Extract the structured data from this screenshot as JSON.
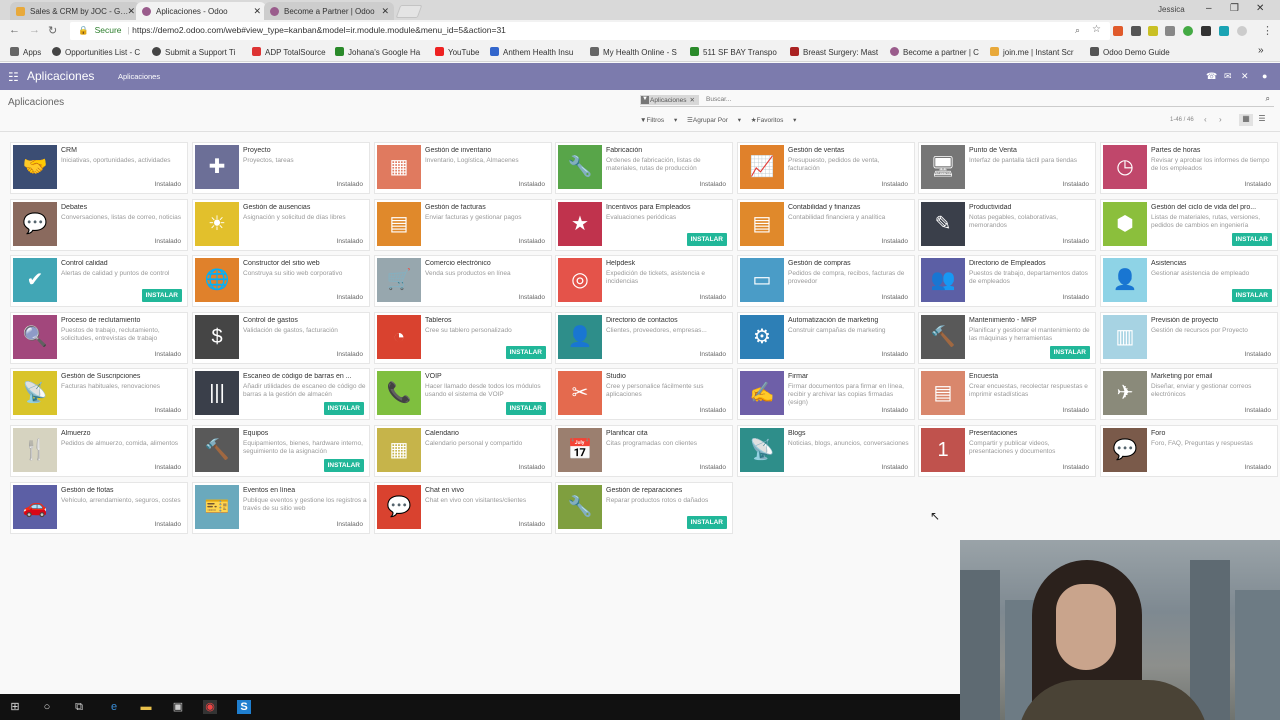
{
  "browser": {
    "tabs": [
      {
        "title": "Sales & CRM by JOC - G…",
        "fav": "#e8a93b",
        "icon": "drive-icon"
      },
      {
        "title": "Aplicaciones - Odoo",
        "fav": "#9a5c8c",
        "icon": "odoo-icon"
      },
      {
        "title": "Become a Partner | Odoo",
        "fav": "#9a5c8c",
        "icon": "odoo-icon"
      }
    ],
    "user": "Jessica",
    "secure_label": "Secure",
    "url": "https://demo2.odoo.com/web#view_type=kanban&model=ir.module.module&menu_id=5&action=31",
    "apps_label": "Apps",
    "bookmarks": [
      {
        "label": "Opportunities List - C",
        "color": "#444"
      },
      {
        "label": "Submit a Support Ti",
        "color": "#444"
      },
      {
        "label": "ADP TotalSource",
        "color": "#d33"
      },
      {
        "label": "Johana's Google Ha",
        "color": "#2a8a2a"
      },
      {
        "label": "YouTube",
        "color": "#e22"
      },
      {
        "label": "Anthem Health Insu",
        "color": "#36c"
      },
      {
        "label": "My Health Online - S",
        "color": "#666"
      },
      {
        "label": "511 SF BAY Transpo",
        "color": "#2a8a2a"
      },
      {
        "label": "Breast Surgery: Mast",
        "color": "#a22"
      },
      {
        "label": "Become a partner | C",
        "color": "#9a5c8c"
      },
      {
        "label": "join.me | Instant Scr",
        "color": "#e8a93b"
      },
      {
        "label": "Odoo Demo Guide",
        "color": "#555"
      }
    ]
  },
  "header": {
    "title": "Aplicaciones",
    "menu": "Aplicaciones"
  },
  "control": {
    "breadcrumb": "Aplicaciones",
    "facet": "Aplicaciones",
    "search_placeholder": "Buscar...",
    "filters": "Filtros",
    "group_by": "Agrupar Por",
    "favorites": "Favoritos",
    "pager": "1-46 / 46"
  },
  "labels": {
    "installed": "Instalado",
    "install": "INSTALAR"
  },
  "apps": [
    {
      "name": "CRM",
      "desc": "Iniciativas, oportunidades, actividades",
      "status": "installed",
      "color": "#3b4d73",
      "glyph": "🤝"
    },
    {
      "name": "Proyecto",
      "desc": "Proyectos, tareas",
      "status": "installed",
      "color": "#6c6f97",
      "glyph": "✚"
    },
    {
      "name": "Gestión de inventario",
      "desc": "Inventario, Logística, Almacenes",
      "status": "installed",
      "color": "#e07a5f",
      "glyph": "▦"
    },
    {
      "name": "Fabricación",
      "desc": "Órdenes de fabricación, listas de materiales, rutas de producción",
      "status": "installed",
      "color": "#58a549",
      "glyph": "🔧"
    },
    {
      "name": "Gestión de ventas",
      "desc": "Presupuesto, pedidos de venta, facturación",
      "status": "installed",
      "color": "#e0812b",
      "glyph": "📈"
    },
    {
      "name": "Punto de Venta",
      "desc": "Interfaz de pantalla táctil para tiendas",
      "status": "installed",
      "color": "#767676",
      "glyph": "🖥"
    },
    {
      "name": "Partes de horas",
      "desc": "Revisar y aprobar los informes de tiempo de los empleados",
      "status": "installed",
      "color": "#c0476b",
      "glyph": "◷"
    },
    {
      "name": "Debates",
      "desc": "Conversaciones, listas de correo, noticias",
      "status": "installed",
      "color": "#8a6a5e",
      "glyph": "💬"
    },
    {
      "name": "Gestión de ausencias",
      "desc": "Asignación y solicitud de días libres",
      "status": "installed",
      "color": "#e2c02c",
      "glyph": "☀"
    },
    {
      "name": "Gestión de facturas",
      "desc": "Enviar facturas y gestionar pagos",
      "status": "installed",
      "color": "#e0892b",
      "glyph": "▤"
    },
    {
      "name": "Incentivos para Empleados",
      "desc": "Evaluaciones periódicas",
      "status": "install",
      "color": "#c0334d",
      "glyph": "★"
    },
    {
      "name": "Contabilidad y finanzas",
      "desc": "Contabilidad financiera y analítica",
      "status": "installed",
      "color": "#e0892b",
      "glyph": "▤"
    },
    {
      "name": "Productividad",
      "desc": "Notas pegables, colaborativas, memorandos",
      "status": "installed",
      "color": "#3a3f4a",
      "glyph": "✎"
    },
    {
      "name": "Gestión del ciclo de vida del pro...",
      "desc": "Listas de materiales, rutas, versiones, pedidos de cambios en ingeniería",
      "status": "install",
      "color": "#8bbf3c",
      "glyph": "⬢"
    },
    {
      "name": "Control calidad",
      "desc": "Alertas de calidad y puntos de control",
      "status": "install",
      "color": "#41a6b5",
      "glyph": "✔"
    },
    {
      "name": "Constructor del sitio web",
      "desc": "Construya su sitio web corporativo",
      "status": "installed",
      "color": "#e0812b",
      "glyph": "🌐"
    },
    {
      "name": "Comercio electrónico",
      "desc": "Venda sus productos en línea",
      "status": "installed",
      "color": "#97a7ae",
      "glyph": "🛒"
    },
    {
      "name": "Helpdesk",
      "desc": "Expedición de tickets, asistencia e incidencias",
      "status": "installed",
      "color": "#e4534a",
      "glyph": "◎"
    },
    {
      "name": "Gestión de compras",
      "desc": "Pedidos de compra, recibos, facturas de proveedor",
      "status": "installed",
      "color": "#4a9cc7",
      "glyph": "▭"
    },
    {
      "name": "Directorio de Empleados",
      "desc": "Puestos de trabajo, departamentos datos de empleados",
      "status": "installed",
      "color": "#5c5fa5",
      "glyph": "👥"
    },
    {
      "name": "Asistencias",
      "desc": "Gestionar asistencia de empleado",
      "status": "install",
      "color": "#8ed3e6",
      "glyph": "👤"
    },
    {
      "name": "Proceso de reclutamiento",
      "desc": "Puestos de trabajo, reclutamiento, solicitudes, entrevistas de trabajo",
      "status": "installed",
      "color": "#a2477c",
      "glyph": "🔍"
    },
    {
      "name": "Control de gastos",
      "desc": "Validación de gastos, facturación",
      "status": "installed",
      "color": "#454545",
      "glyph": "$"
    },
    {
      "name": "Tableros",
      "desc": "Cree su tablero personalizado",
      "status": "install",
      "color": "#d9422f",
      "glyph": "◔"
    },
    {
      "name": "Directorio de contactos",
      "desc": "Clientes, proveedores, empresas...",
      "status": "installed",
      "color": "#2e8e8a",
      "glyph": "👤"
    },
    {
      "name": "Automatización de marketing",
      "desc": "Construir campañas de marketing",
      "status": "installed",
      "color": "#2d7fb6",
      "glyph": "⚙"
    },
    {
      "name": "Mantenimiento - MRP",
      "desc": "Planificar y gestionar el mantenimiento de las máquinas y herramientas",
      "status": "install",
      "color": "#595959",
      "glyph": "🔨"
    },
    {
      "name": "Previsión de proyecto",
      "desc": "Gestión de recursos por Proyecto",
      "status": "installed",
      "color": "#a7d3e3",
      "glyph": "▥"
    },
    {
      "name": "Gestión de Suscripciones",
      "desc": "Facturas habituales, renovaciones",
      "status": "installed",
      "color": "#d9c42a",
      "glyph": "📡"
    },
    {
      "name": "Escaneo de código de barras en ...",
      "desc": "Añadir utilidades de escaneo de código de barras a la gestión de almacén",
      "status": "install",
      "color": "#3a3f4a",
      "glyph": "|||"
    },
    {
      "name": "VOIP",
      "desc": "Hacer llamado desde todos los módulos usando el sistema de VOIP",
      "status": "install",
      "color": "#7fbf3f",
      "glyph": "📞"
    },
    {
      "name": "Studio",
      "desc": "Cree y personalice fácilmente sus aplicaciones",
      "status": "installed",
      "color": "#e46a4e",
      "glyph": "✂"
    },
    {
      "name": "Firmar",
      "desc": "Firmar documentos para firmar en línea, recibir y archivar las copias firmadas (esign)",
      "status": "installed",
      "color": "#6e5fa8",
      "glyph": "✍"
    },
    {
      "name": "Encuesta",
      "desc": "Crear encuestas, recolectar respuestas e imprimir estadísticas",
      "status": "installed",
      "color": "#d9876c",
      "glyph": "▤"
    },
    {
      "name": "Marketing por email",
      "desc": "Diseñar, enviar y gestionar correos electrónicos",
      "status": "installed",
      "color": "#8a8a7a",
      "glyph": "✈"
    },
    {
      "name": "Almuerzo",
      "desc": "Pedidos de almuerzo, comida, alimentos",
      "status": "installed",
      "color": "#d6d3c0",
      "glyph": "🍴"
    },
    {
      "name": "Equipos",
      "desc": "Equipamientos, bienes, hardware interno, seguimiento de la asignación",
      "status": "install",
      "color": "#595959",
      "glyph": "🔨"
    },
    {
      "name": "Calendario",
      "desc": "Calendario personal y compartido",
      "status": "installed",
      "color": "#c6b44a",
      "glyph": "▦"
    },
    {
      "name": "Planificar cita",
      "desc": "Citas programadas con clientes",
      "status": "installed",
      "color": "#9b7f6f",
      "glyph": "📅"
    },
    {
      "name": "Blogs",
      "desc": "Noticias, blogs, anuncios, conversaciones",
      "status": "installed",
      "color": "#2e8e8a",
      "glyph": "📡"
    },
    {
      "name": "Presentaciones",
      "desc": "Compartir y publicar videos, presentaciones y documentos",
      "status": "installed",
      "color": "#c0524d",
      "glyph": "1"
    },
    {
      "name": "Foro",
      "desc": "Foro, FAQ, Preguntas y respuestas",
      "status": "installed",
      "color": "#7a5a4a",
      "glyph": "💬"
    },
    {
      "name": "Gestión de flotas",
      "desc": "Vehículo, arrendamiento, seguros, costes",
      "status": "installed",
      "color": "#5c5fa5",
      "glyph": "🚗"
    },
    {
      "name": "Eventos en línea",
      "desc": "Publique eventos y gestione los registros a través de su sitio web",
      "status": "installed",
      "color": "#6aa9bd",
      "glyph": "🎫"
    },
    {
      "name": "Chat en vivo",
      "desc": "Chat en vivo con visitantes/clientes",
      "status": "installed",
      "color": "#d9422f",
      "glyph": "💬"
    },
    {
      "name": "Gestión de reparaciones",
      "desc": "Reparar productos rotos o dañados",
      "status": "install",
      "color": "#7f9f3f",
      "glyph": "🔧"
    }
  ]
}
